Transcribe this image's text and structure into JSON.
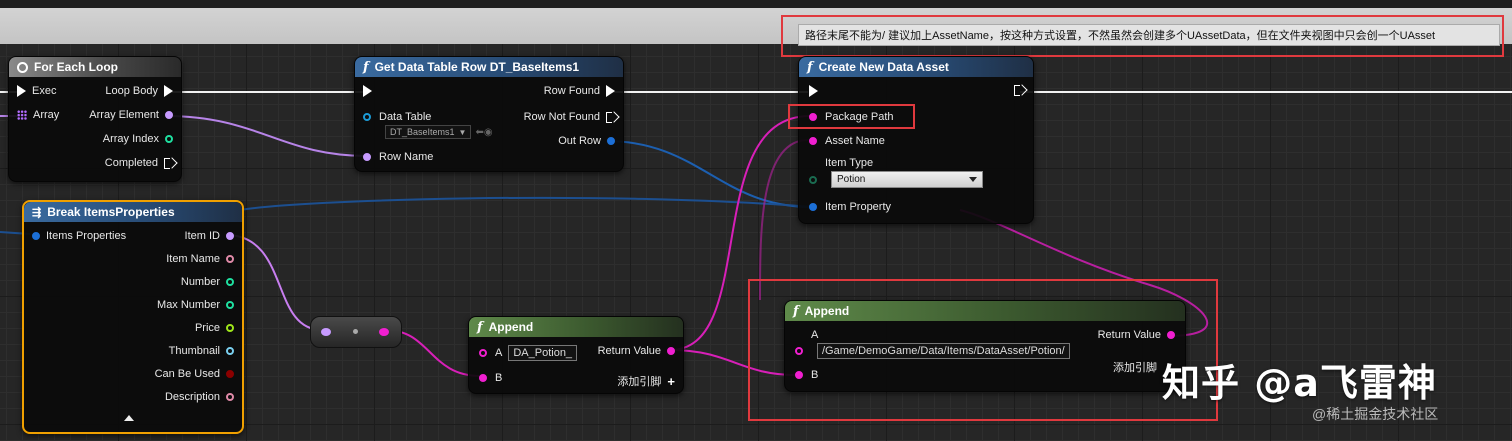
{
  "tooltip": "路径末尾不能为/ 建议加上AssetName，按这种方式设置，不然虽然会创建多个UAssetData，但在文件夹视图中只会创一个UAsset",
  "nodes": {
    "for_each_loop": {
      "title": "For Each Loop",
      "exec": "Exec",
      "array": "Array",
      "loop_body": "Loop Body",
      "array_element": "Array Element",
      "array_index": "Array Index",
      "completed": "Completed"
    },
    "get_row": {
      "title": "Get Data Table Row DT_BaseItems1",
      "data_table": "Data Table",
      "data_table_value": "DT_BaseItems1",
      "row_name": "Row Name",
      "row_found": "Row Found",
      "row_not_found": "Row Not Found",
      "out_row": "Out Row"
    },
    "create_asset": {
      "title": "Create New Data Asset",
      "package_path": "Package Path",
      "asset_name": "Asset Name",
      "item_type": "Item Type",
      "item_type_value": "Potion",
      "item_property": "Item Property"
    },
    "break_props": {
      "title": "Break ItemsProperties",
      "input": "Items Properties",
      "outputs": [
        "Item ID",
        "Item Name",
        "Number",
        "Max Number",
        "Price",
        "Thumbnail",
        "Can Be Used",
        "Description"
      ]
    },
    "append_small": {
      "title": "Append",
      "a": "A",
      "a_value": "DA_Potion_",
      "b": "B",
      "return_value": "Return Value",
      "add_pin": "添加引脚"
    },
    "append_big": {
      "title": "Append",
      "a": "A",
      "a_value": "/Game/DemoGame/Data/Items/DataAsset/Potion/",
      "b": "B",
      "return_value": "Return Value",
      "add_pin": "添加引脚"
    }
  },
  "watermark": {
    "main": "知乎 @a飞雷神",
    "sub": "@稀土掘金技术社区"
  },
  "colors": {
    "exec": "#ffffff",
    "string_pin": "#f01fd0",
    "struct_pin": "#1c6fd6",
    "name_pin": "#c79bff",
    "int_pin": "#1fe0a0",
    "float_pin": "#9ee61a",
    "bool_pin": "#8b0000",
    "highlight": "#e0393e"
  }
}
